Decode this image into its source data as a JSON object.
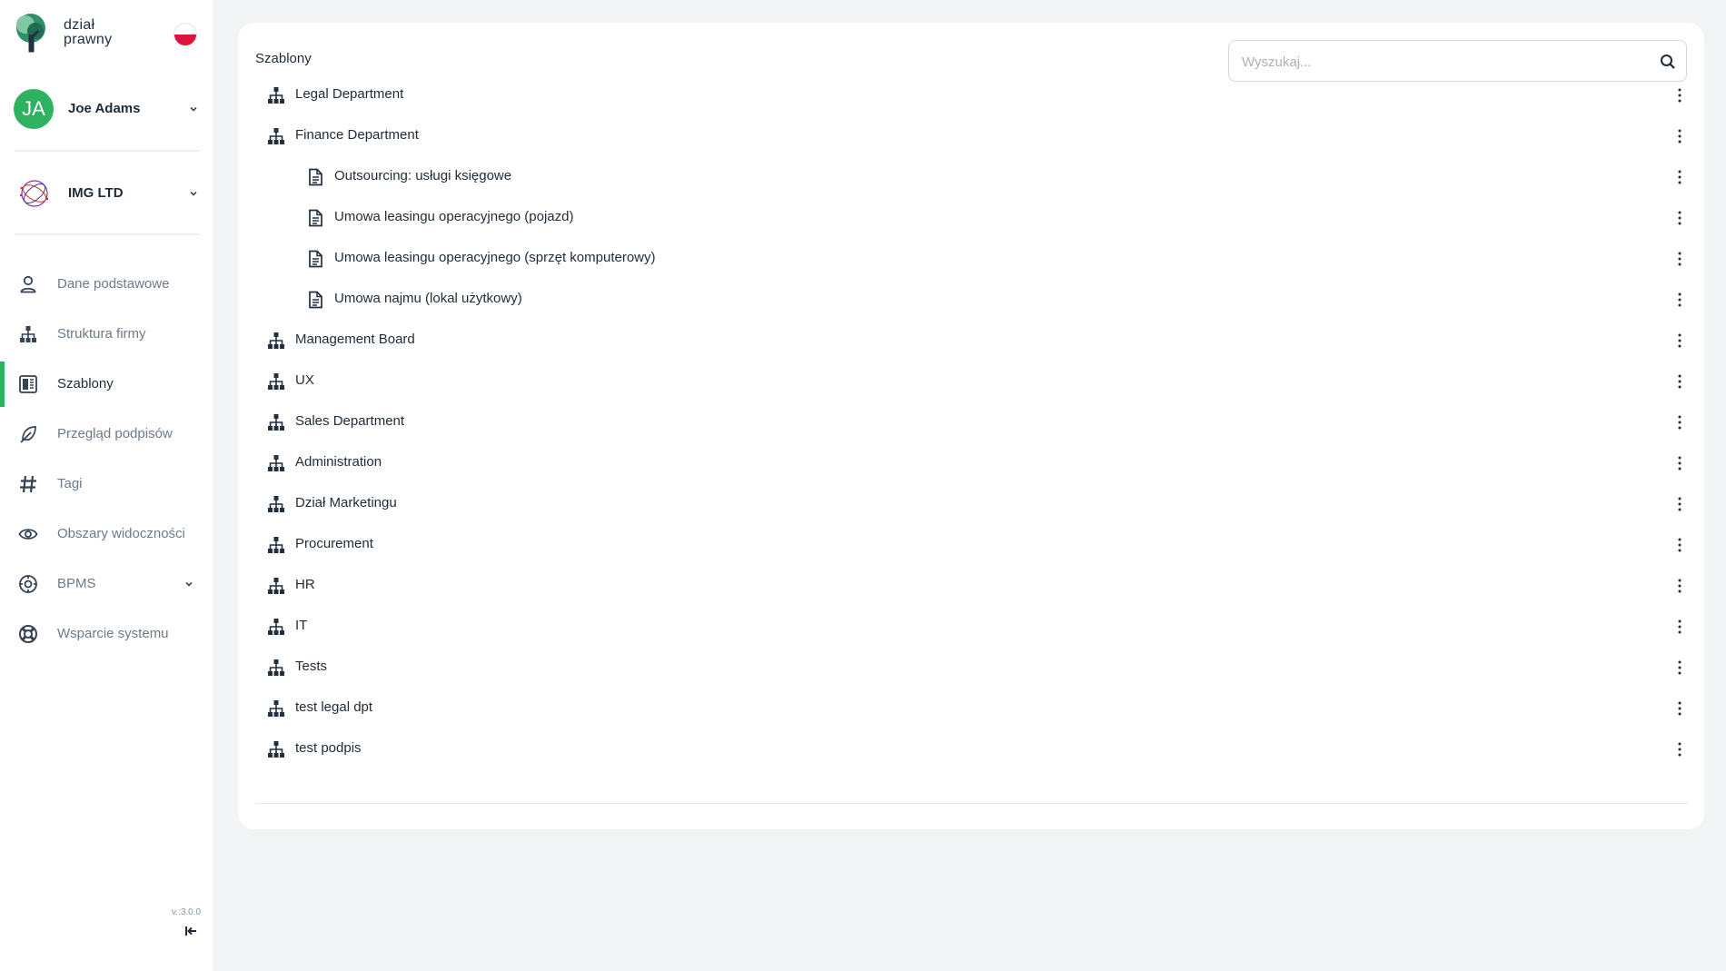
{
  "brand": {
    "logo_line1": "dział",
    "logo_line2": "prawny",
    "colors": {
      "accent": "#2fb260",
      "flag_top": "#ffffff",
      "flag_bottom": "#dc143c"
    }
  },
  "user": {
    "initials": "JA",
    "name": "Joe Adams"
  },
  "company": {
    "name": "IMG LTD"
  },
  "nav": {
    "items": [
      {
        "label": "Dane podstawowe",
        "icon": "user-icon"
      },
      {
        "label": "Struktura firmy",
        "icon": "org-structure-icon"
      },
      {
        "label": "Szablony",
        "icon": "templates-icon",
        "active": true
      },
      {
        "label": "Przegląd podpisów",
        "icon": "feather-pen-icon"
      },
      {
        "label": "Tagi",
        "icon": "hashtag-icon"
      },
      {
        "label": "Obszary widoczności",
        "icon": "eye-icon"
      },
      {
        "label": "BPMS",
        "icon": "process-icon",
        "has_submenu": true
      },
      {
        "label": "Wsparcie systemu",
        "icon": "lifebuoy-icon"
      }
    ]
  },
  "version": "v.:3.0.0",
  "main": {
    "title": "Szablony",
    "search": {
      "placeholder": "Wyszukaj...",
      "value": ""
    },
    "tree": [
      {
        "type": "dept",
        "label": "Legal Department"
      },
      {
        "type": "dept",
        "label": "Finance Department"
      },
      {
        "type": "doc",
        "label": "Outsourcing: usługi księgowe"
      },
      {
        "type": "doc",
        "label": "Umowa leasingu operacyjnego (pojazd)"
      },
      {
        "type": "doc",
        "label": "Umowa leasingu operacyjnego (sprzęt komputerowy)"
      },
      {
        "type": "doc",
        "label": "Umowa najmu (lokal użytkowy)"
      },
      {
        "type": "dept",
        "label": "Management Board"
      },
      {
        "type": "dept",
        "label": "UX"
      },
      {
        "type": "dept",
        "label": "Sales Department"
      },
      {
        "type": "dept",
        "label": "Administration"
      },
      {
        "type": "dept",
        "label": "Dział Marketingu"
      },
      {
        "type": "dept",
        "label": "Procurement"
      },
      {
        "type": "dept",
        "label": "HR"
      },
      {
        "type": "dept",
        "label": "IT"
      },
      {
        "type": "dept",
        "label": "Tests"
      },
      {
        "type": "dept",
        "label": "test legal dpt"
      },
      {
        "type": "dept",
        "label": "test podpis"
      }
    ]
  }
}
